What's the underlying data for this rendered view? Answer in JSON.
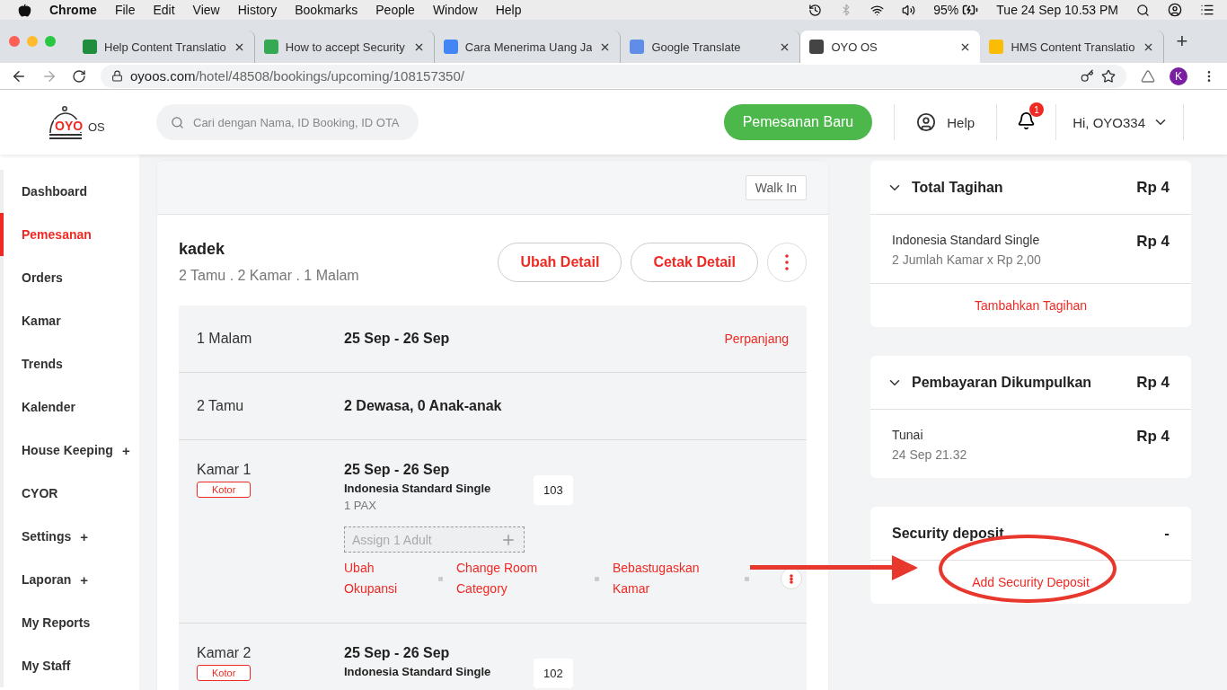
{
  "menubar": {
    "app": "Chrome",
    "items": [
      "File",
      "Edit",
      "View",
      "History",
      "Bookmarks",
      "People",
      "Window",
      "Help"
    ],
    "battery": "95%",
    "clock": "Tue 24 Sep  10.53 PM"
  },
  "browser": {
    "tabs": [
      {
        "title": "Help Content Translatio",
        "selected": false,
        "color": "#1e8e3e"
      },
      {
        "title": "How to accept Security",
        "selected": false,
        "color": "#34a853"
      },
      {
        "title": "Cara Menerima Uang Ja",
        "selected": false,
        "color": "#4285f4"
      },
      {
        "title": "Google Translate",
        "selected": false,
        "color": "#5f8de8"
      },
      {
        "title": "OYO OS",
        "selected": true,
        "color": "#444444"
      },
      {
        "title": "HMS Content Translatio",
        "selected": false,
        "color": "#fbbc04"
      }
    ],
    "new_tab": "+",
    "url_host": "oyoos.com",
    "url_path": "/hotel/48508/bookings/upcoming/108157350/",
    "profile": "K"
  },
  "header": {
    "brand": "OYO",
    "brand_suffix": "OS",
    "search_placeholder": "Cari dengan Nama, ID Booking, ID OTA",
    "new_booking": "Pemesanan Baru",
    "help": "Help",
    "notifications": "1",
    "user": "Hi, OYO334"
  },
  "sidebar": {
    "items": [
      {
        "label": "Dashboard",
        "selected": false
      },
      {
        "label": "Pemesanan",
        "selected": true
      },
      {
        "label": "Orders",
        "selected": false
      },
      {
        "label": "Kamar",
        "selected": false
      },
      {
        "label": "Trends",
        "selected": false
      },
      {
        "label": "Kalender",
        "selected": false
      },
      {
        "label": "House Keeping",
        "selected": false,
        "expand": "+"
      },
      {
        "label": "CYOR",
        "selected": false
      },
      {
        "label": "Settings",
        "selected": false,
        "expand": "+"
      },
      {
        "label": "Laporan",
        "selected": false,
        "expand": "+"
      },
      {
        "label": "My Reports",
        "selected": false
      },
      {
        "label": "My Staff",
        "selected": false
      }
    ]
  },
  "booking": {
    "walk_in": "Walk In",
    "guest": "kadek",
    "summary": "2 Tamu . 2 Kamar . 1 Malam",
    "buttons": [
      "Ubah Detail",
      "Cetak Detail"
    ],
    "info_rows": [
      {
        "label": "1 Malam",
        "value": "25 Sep - 26 Sep",
        "action": "Perpanjang"
      },
      {
        "label": "2 Tamu",
        "value": "2 Dewasa, 0 Anak-anak"
      }
    ],
    "rooms": [
      {
        "label": "Kamar 1",
        "status": "Kotor",
        "dates": "25 Sep - 26 Sep",
        "type": "Indonesia Standard Single",
        "pax": "1 PAX",
        "number": "103",
        "assign": "Assign 1 Adult",
        "actions": [
          "Ubah Okupansi",
          "Change Room Category",
          "Bebastugaskan Kamar"
        ]
      },
      {
        "label": "Kamar 2",
        "status": "Kotor",
        "dates": "25 Sep - 26 Sep",
        "type": "Indonesia Standard Single",
        "number": "102"
      }
    ]
  },
  "panels": [
    {
      "kind": "bill",
      "title": "Total Tagihan",
      "amount": "Rp 4",
      "expanded": true,
      "lines": [
        {
          "name": "Indonesia Standard Single",
          "detail": "2 Jumlah Kamar x Rp 2,00",
          "amount": "Rp 4"
        }
      ],
      "link": "Tambahkan Tagihan"
    },
    {
      "kind": "bill",
      "title": "Pembayaran Dikumpulkan",
      "amount": "Rp 4",
      "expanded": true,
      "lines": [
        {
          "name": "Tunai",
          "detail": "24 Sep 21.32",
          "amount": "Rp 4"
        }
      ]
    },
    {
      "kind": "deposit",
      "title": "Security deposit",
      "amount": "-",
      "link": "Add Security Deposit"
    }
  ]
}
